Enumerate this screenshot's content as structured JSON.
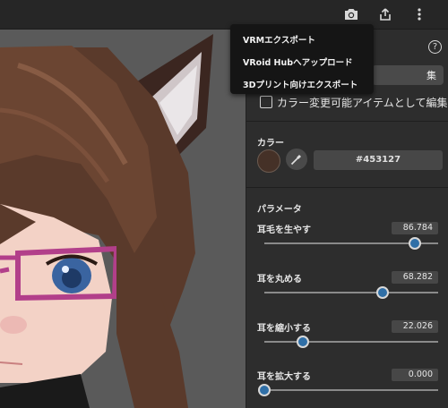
{
  "topbar": {
    "icons": [
      "camera-icon",
      "share-icon",
      "more-vert-icon"
    ]
  },
  "menu": {
    "items": [
      "VRMエクスポート",
      "VRoid Hubへアップロード",
      "3Dプリント向けエクスポート"
    ]
  },
  "panel": {
    "help_icon": "?",
    "edit_button_label": "集",
    "checkbox_label": "カラー変更可能アイテムとして編集",
    "color_section": {
      "title": "カラー",
      "swatch_color": "#453127",
      "hex_value": "#453127"
    },
    "params_section": {
      "title": "パラメータ",
      "params": [
        {
          "label": "耳毛を生やす",
          "value": "86.784",
          "level": 0.86784
        },
        {
          "label": "耳を丸める",
          "value": "68.282",
          "level": 0.68282
        },
        {
          "label": "耳を縮小する",
          "value": "22.026",
          "level": 0.22026
        },
        {
          "label": "耳を拡大する",
          "value": "0.000",
          "level": 0.0
        }
      ]
    }
  }
}
